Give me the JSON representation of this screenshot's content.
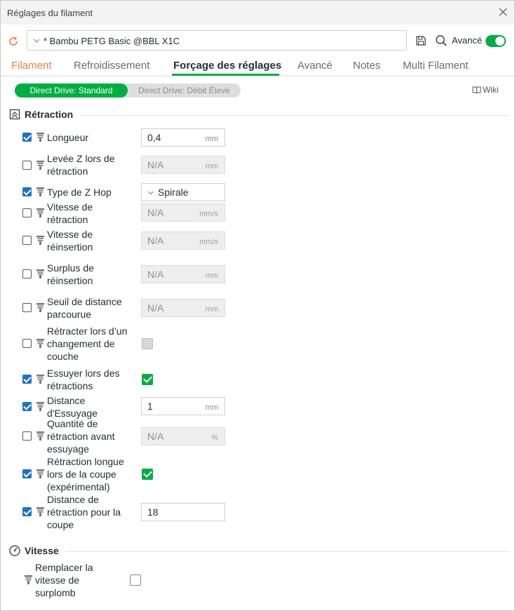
{
  "window": {
    "title": "Réglages du filament"
  },
  "toolbar": {
    "preset_value": "* Bambu PETG Basic @BBL X1C",
    "advanced_label": "Avancé",
    "advanced_on": true
  },
  "tabs": [
    {
      "label": "Filament"
    },
    {
      "label": "Refroidissement"
    },
    {
      "label": "Forçage des réglages"
    },
    {
      "label": "Avancé"
    },
    {
      "label": "Notes"
    },
    {
      "label": "Multi Filament"
    }
  ],
  "subtabs": {
    "active": "Direct Drive: Standard",
    "inactive": "Direct Drive: Débit Élevé"
  },
  "wiki_label": "Wiki",
  "sections": {
    "retraction": {
      "title": "Rétraction"
    },
    "speed": {
      "title": "Vitesse"
    }
  },
  "rows": [
    {
      "label": "Longueur",
      "value": "0,4",
      "unit": "mm"
    },
    {
      "label": "Levée Z lors de rétraction",
      "value": "N/A",
      "unit": "mm"
    },
    {
      "label": "Type de Z Hop",
      "value": "Spirale"
    },
    {
      "label": "Vitesse de rétraction",
      "value": "N/A",
      "unit": "mm/s"
    },
    {
      "label": "Vitesse de réinsertion",
      "value": "N/A",
      "unit": "mm/s"
    },
    {
      "label": "Surplus de réinsertion",
      "value": "N/A",
      "unit": "mm"
    },
    {
      "label": "Seuil de distance parcourue",
      "value": "N/A",
      "unit": "mm"
    },
    {
      "label": "Rétracter lors d’un changement de couche"
    },
    {
      "label": "Essuyer lors des rétractions"
    },
    {
      "label": "Distance d'Essuyage",
      "value": "1",
      "unit": "mm"
    },
    {
      "label": "Quantité de rétraction avant essuyage",
      "value": "N/A",
      "unit": "%"
    },
    {
      "label": "Rétraction longue lors de la coupe (expérimental)"
    },
    {
      "label": "Distance de rétraction pour la coupe",
      "value": "18"
    },
    {
      "label": "Remplacer la vitesse de surplomb"
    }
  ],
  "colors": {
    "accent": "#00ae42",
    "checkbox_blue": "#1a73c8",
    "tab_orange": "#f07f3c"
  }
}
